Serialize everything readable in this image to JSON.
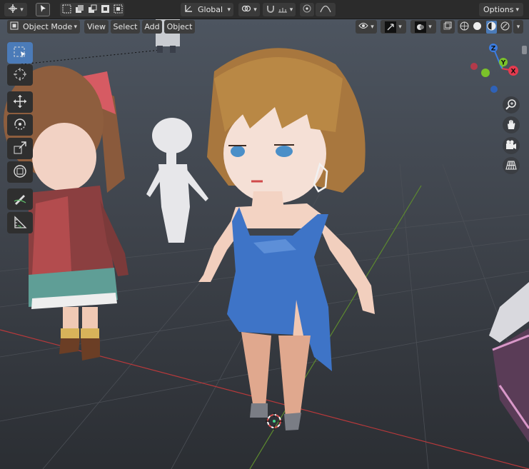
{
  "topbar": {
    "transform_orientation": "Global",
    "options_label": "Options"
  },
  "header": {
    "mode_label": "Object Mode",
    "menus": [
      "View",
      "Select",
      "Add",
      "Object"
    ]
  },
  "toolbar": {
    "tools": [
      "select-box-tool",
      "cursor-tool",
      "move-tool",
      "rotate-tool",
      "scale-tool",
      "transform-tool",
      "annotate-tool",
      "measure-tool"
    ]
  },
  "gizmo": {
    "axes": [
      "X",
      "Y",
      "Z"
    ],
    "colors": {
      "x": "#e63a4e",
      "y": "#7bc22a",
      "z": "#3b7de3"
    }
  },
  "navigation": [
    "zoom-icon",
    "hand-pan-icon",
    "camera-icon",
    "grid-perspective-icon"
  ],
  "colors": {
    "accent": "#4b7bb8",
    "x_axis_line": "#b8393b",
    "y_axis_line": "#5d8a2f"
  }
}
